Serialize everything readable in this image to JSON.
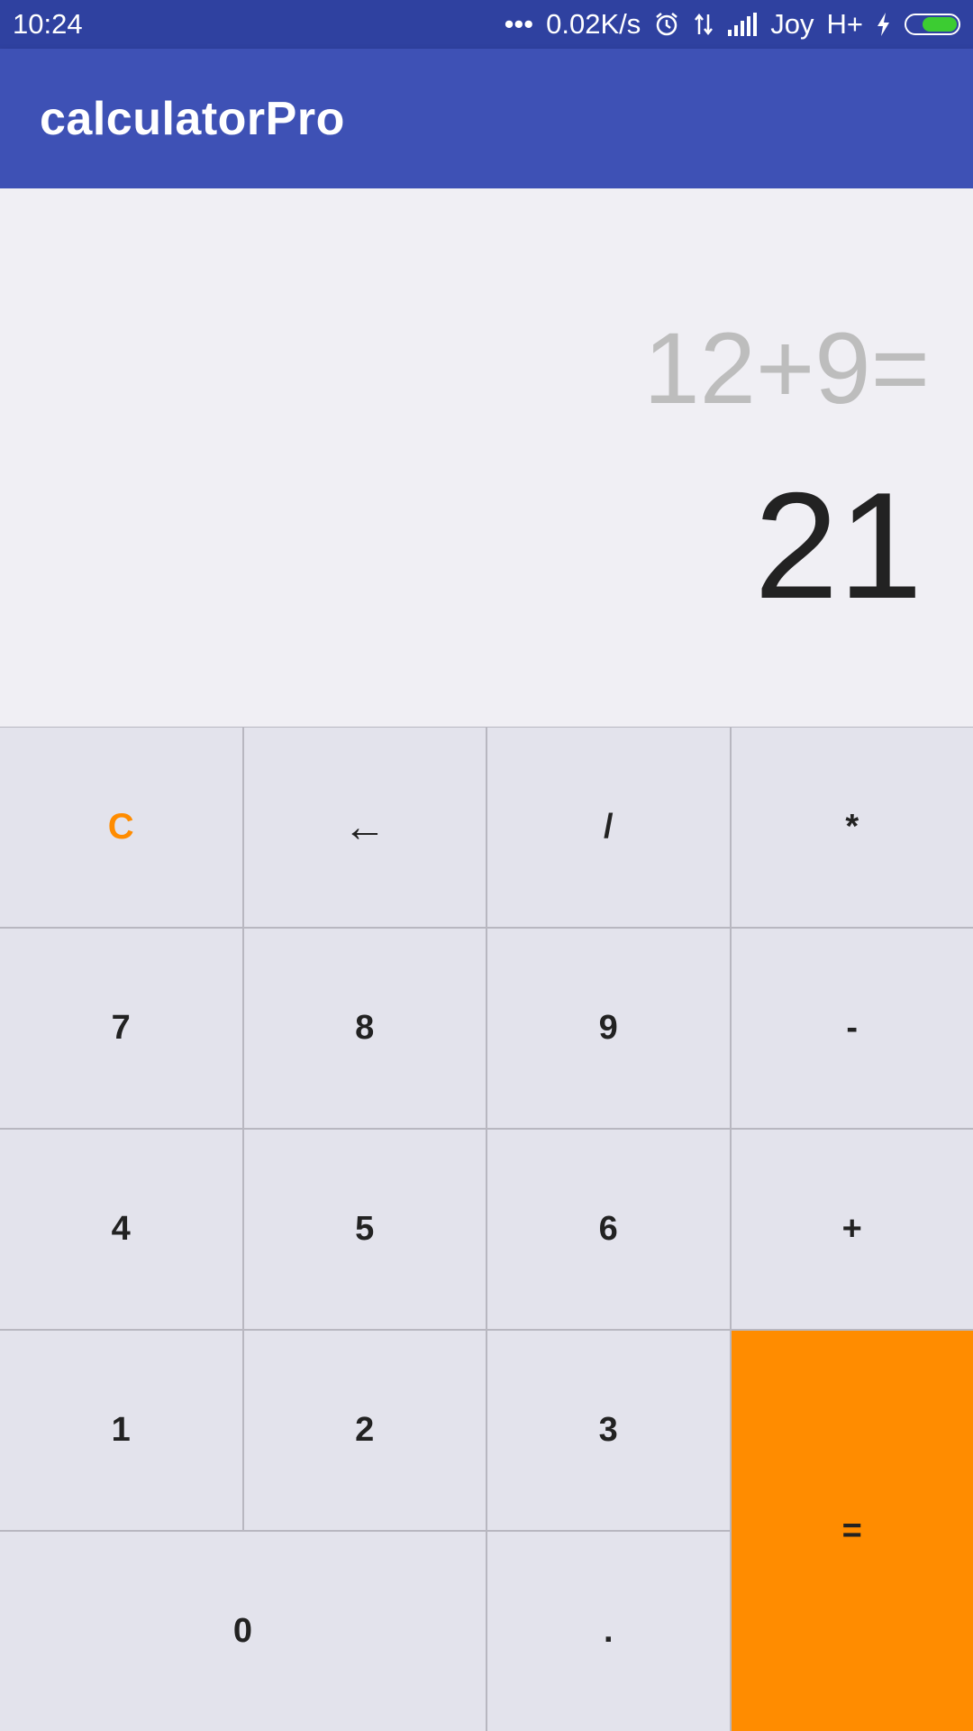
{
  "status_bar": {
    "time": "10:24",
    "dots": "•••",
    "network_speed": "0.02K/s",
    "carrier": "Joy",
    "network_type": "H+",
    "icons": [
      "alarm-icon",
      "data-transfer-icon",
      "signal-icon",
      "charging-icon",
      "battery-icon"
    ],
    "battery_color": "#3ccc32"
  },
  "app_bar": {
    "title": "calculatorPro",
    "color": "#3e51b5"
  },
  "display": {
    "expression": "12+9=",
    "result": "21"
  },
  "keys": {
    "clear": "C",
    "backspace": "←",
    "divide": "/",
    "multiply": "*",
    "seven": "7",
    "eight": "8",
    "nine": "9",
    "minus": "-",
    "four": "4",
    "five": "5",
    "six": "6",
    "plus": "+",
    "one": "1",
    "two": "2",
    "three": "3",
    "equals": "=",
    "zero": "0",
    "decimal": "."
  },
  "colors": {
    "accent": "#ff8c00",
    "key_background": "#e3e3ec",
    "display_background": "#f0eff4"
  }
}
